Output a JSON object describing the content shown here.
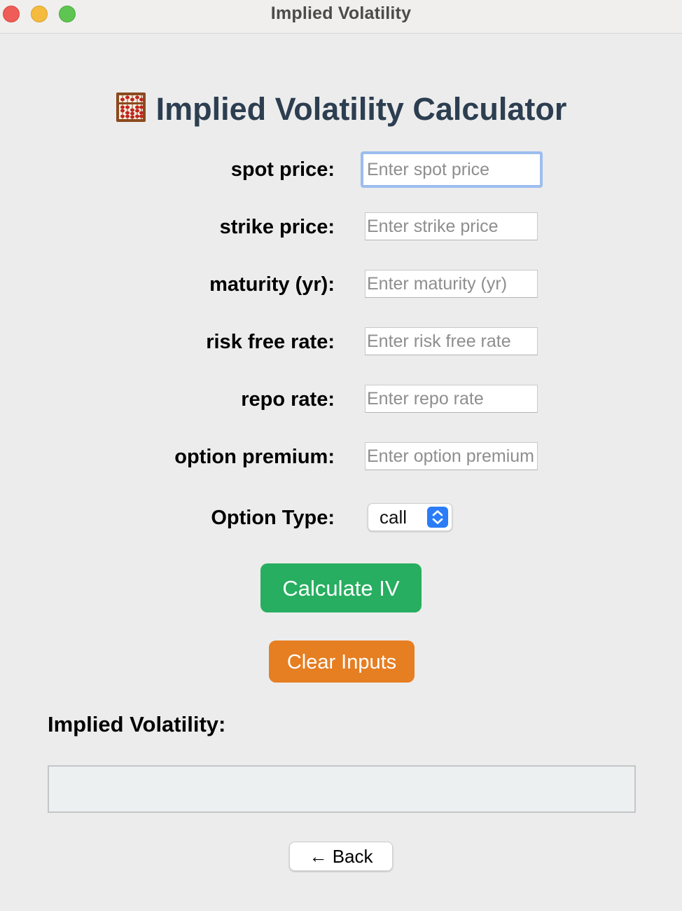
{
  "window": {
    "title": "Implied Volatility"
  },
  "heading": {
    "icon": "abacus-icon",
    "text": "Implied Volatility Calculator"
  },
  "form": {
    "fields": [
      {
        "label": "spot price:",
        "placeholder": "Enter spot price",
        "value": "",
        "focused": true
      },
      {
        "label": "strike price:",
        "placeholder": "Enter strike price",
        "value": ""
      },
      {
        "label": "maturity (yr):",
        "placeholder": "Enter maturity (yr)",
        "value": ""
      },
      {
        "label": "risk free rate:",
        "placeholder": "Enter risk free rate",
        "value": ""
      },
      {
        "label": "repo rate:",
        "placeholder": "Enter repo rate",
        "value": ""
      },
      {
        "label": "option premium:",
        "placeholder": "Enter option premium",
        "value": ""
      }
    ],
    "option_type": {
      "label": "Option Type:",
      "selected": "call"
    }
  },
  "buttons": {
    "calculate": "Calculate IV",
    "clear": "Clear Inputs",
    "back": "← Back"
  },
  "result": {
    "label": "Implied Volatility:",
    "value": ""
  },
  "colors": {
    "heading": "#2c3e50",
    "calculate": "#27ae60",
    "clear": "#e67e22",
    "select_accent": "#2a7cf7",
    "focus_ring": "#9cbdee"
  }
}
